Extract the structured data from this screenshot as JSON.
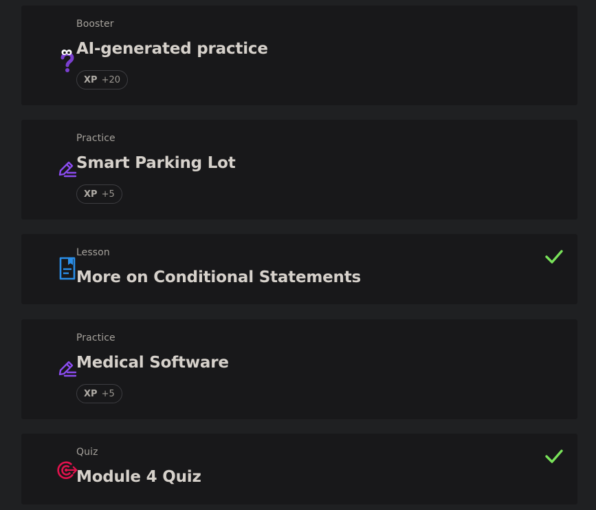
{
  "colors": {
    "background": "#1f2022",
    "card": "#18181a",
    "booster_icon": "#7a3fcf",
    "practice_icon": "#8b4cf0",
    "lesson_icon": "#2a8ee8",
    "quiz_icon": "#e0124d",
    "check": "#79e35a"
  },
  "items": [
    {
      "kind": "Booster",
      "title": "AI-generated practice",
      "icon": "question-mascot-icon",
      "xp_label": "XP",
      "xp_value": "+20",
      "completed": false
    },
    {
      "kind": "Practice",
      "title": "Smart Parking Lot",
      "icon": "pencil-lines-icon",
      "xp_label": "XP",
      "xp_value": "+5",
      "completed": false
    },
    {
      "kind": "Lesson",
      "title": "More on Conditional Statements",
      "icon": "bookmark-document-icon",
      "completed": true
    },
    {
      "kind": "Practice",
      "title": "Medical Software",
      "icon": "pencil-lines-icon",
      "xp_label": "XP",
      "xp_value": "+5",
      "completed": false
    },
    {
      "kind": "Quiz",
      "title": "Module 4 Quiz",
      "icon": "target-arrow-icon",
      "completed": true
    }
  ]
}
